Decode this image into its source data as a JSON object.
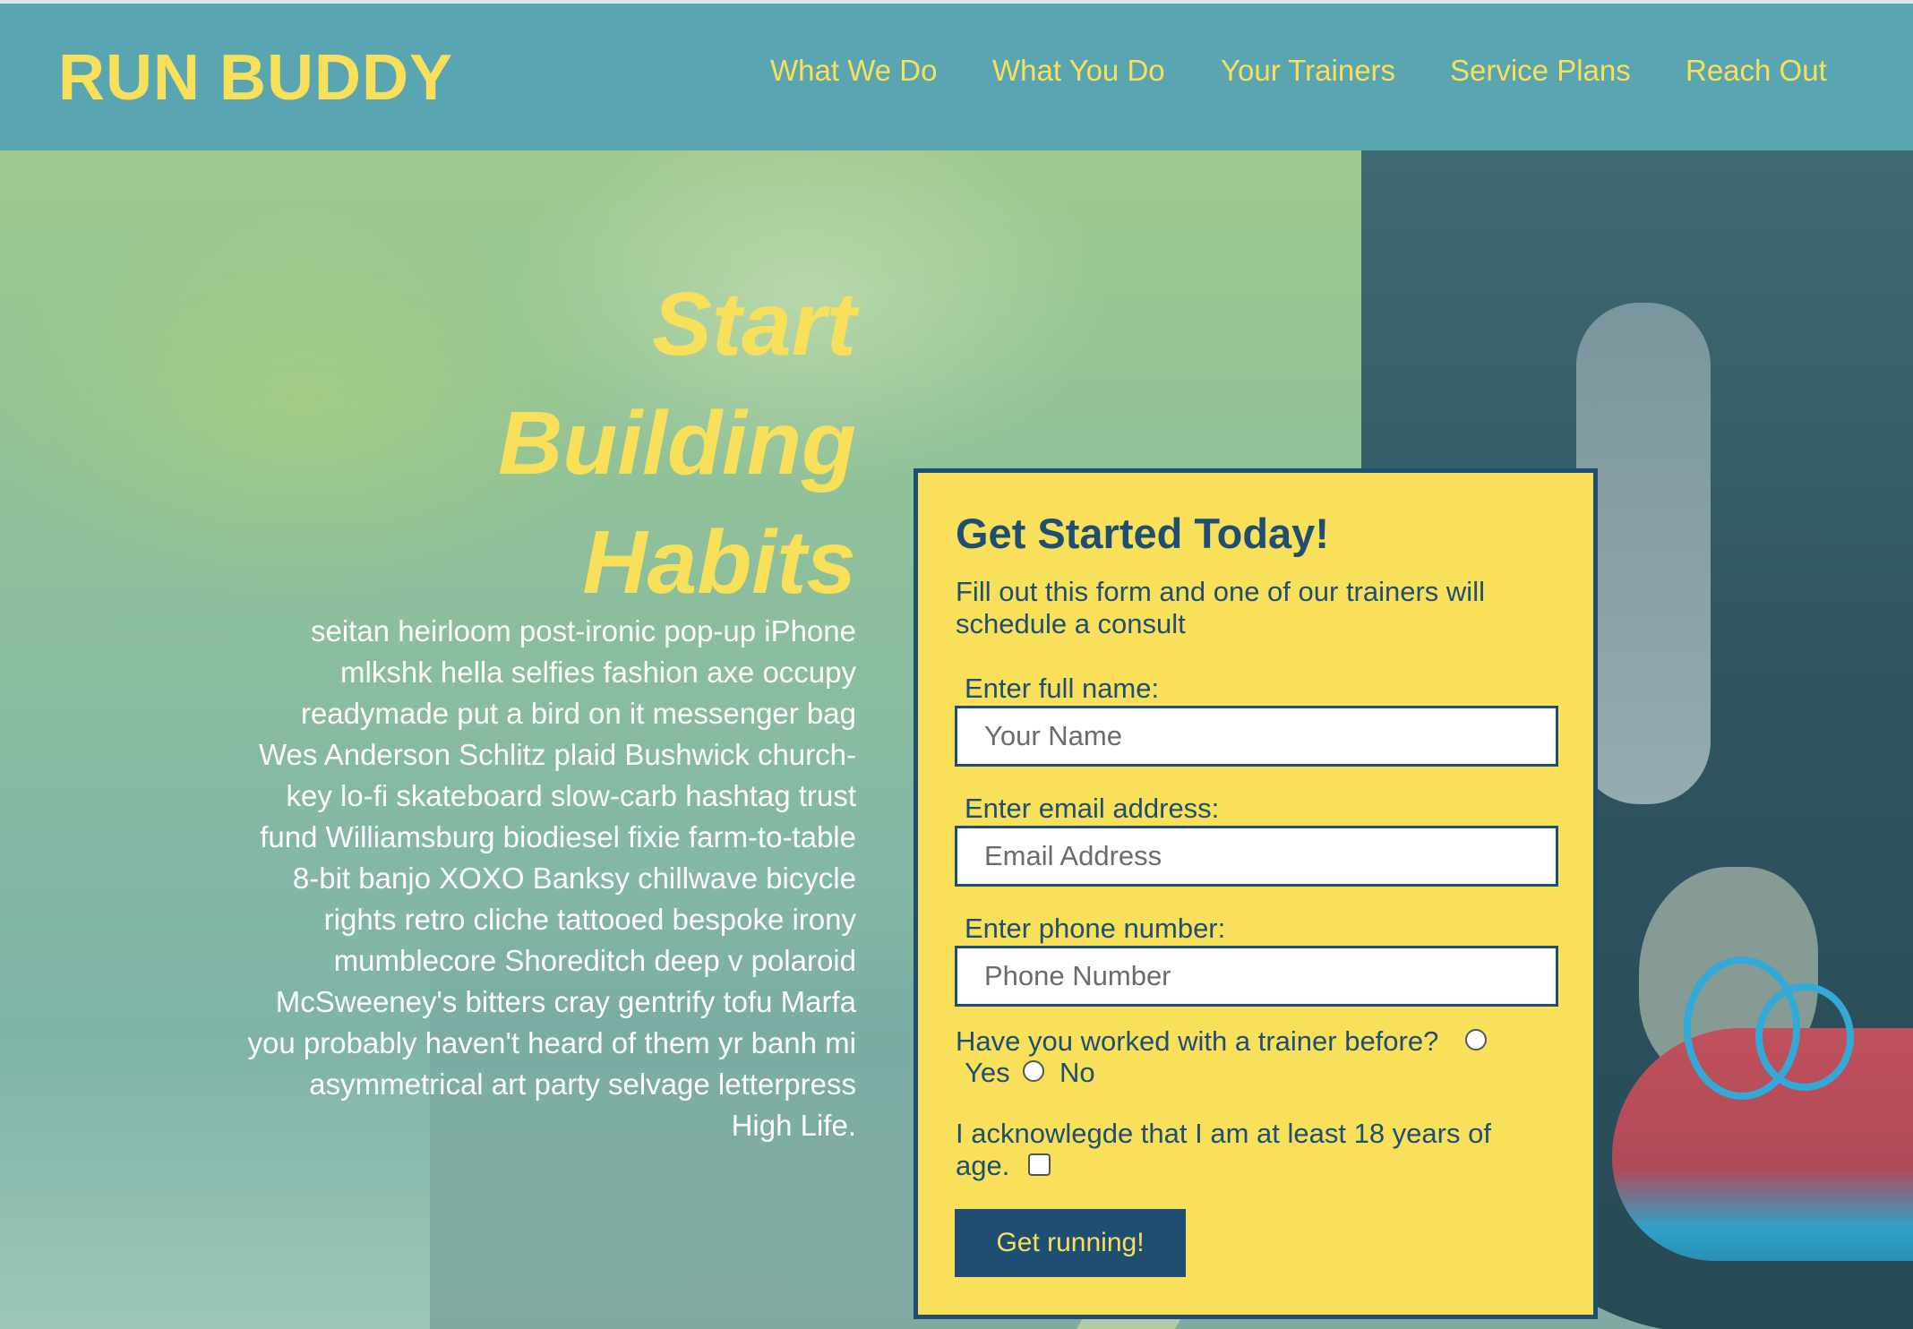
{
  "header": {
    "brand": "RUN BUDDY",
    "nav": [
      {
        "label": "What We Do"
      },
      {
        "label": "What You Do"
      },
      {
        "label": "Your Trainers"
      },
      {
        "label": "Service Plans"
      },
      {
        "label": "Reach Out"
      }
    ]
  },
  "hero": {
    "title_lines": [
      "Start",
      "Building",
      "Habits"
    ],
    "copy": "seitan heirloom post-ironic pop-up iPhone mlkshk hella selfies fashion axe occupy readymade put a bird on it messenger bag Wes Anderson Schlitz plaid Bushwick church-key lo-fi skateboard slow-carb hashtag trust fund Williamsburg biodiesel fixie farm-to-table 8-bit banjo XOXO Banksy chillwave bicycle rights retro cliche tattooed bespoke irony mumblecore Shoreditch deep v polaroid McSweeney's bitters cray gentrify tofu Marfa you probably haven't heard of them yr banh mi asymmetrical art party selvage letterpress High Life."
  },
  "form": {
    "title": "Get Started Today!",
    "subtitle": "Fill out this form and one of our trainers will schedule a consult",
    "name": {
      "label": "Enter full name:",
      "placeholder": "Your Name",
      "value": ""
    },
    "email": {
      "label": "Enter email address:",
      "placeholder": "Email Address",
      "value": ""
    },
    "phone": {
      "label": "Enter phone number:",
      "placeholder": "Phone Number",
      "value": ""
    },
    "trainer_question": "Have you worked with a trainer before?",
    "option_yes": "Yes",
    "option_no": "No",
    "age_ack": "I acknowlegde that I am at least 18 years of age.",
    "submit_label": "Get running!"
  },
  "colors": {
    "header_bg": "#5aa5b2",
    "accent_yellow": "#f9e05a",
    "navy": "#1e4e72"
  }
}
